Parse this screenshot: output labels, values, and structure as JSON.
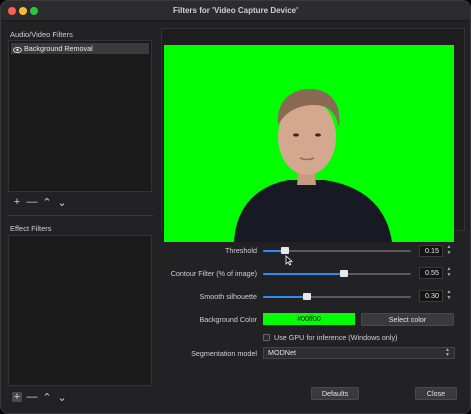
{
  "window": {
    "title": "Filters for 'Video Capture Device'"
  },
  "audio_video_filters": {
    "label": "Audio/Video Filters",
    "items": [
      {
        "label": "Background Removal",
        "visible": true
      }
    ],
    "toolbar": {
      "add": "+",
      "remove": "—",
      "up": "⌃",
      "down": "⌄"
    }
  },
  "effect_filters": {
    "label": "Effect Filters",
    "toolbar": {
      "add": "+",
      "remove": "—",
      "up": "⌃",
      "down": "⌄"
    }
  },
  "properties": {
    "threshold": {
      "label": "Threshold",
      "value": "0.15",
      "fraction": 0.15
    },
    "contour_filter": {
      "label": "Contour Filter (% of image)",
      "value": "0.55",
      "fraction": 0.55
    },
    "smooth_silhouette": {
      "label": "Smooth silhouette",
      "value": "0.30",
      "fraction": 0.3
    },
    "background_color": {
      "label": "Background Color",
      "value": "#00ff00",
      "button": "Select color"
    },
    "use_gpu": {
      "label": "Use GPU for inference (Windows only)",
      "checked": false
    },
    "segmentation_model": {
      "label": "Segmentation model",
      "value": "MODNet"
    }
  },
  "footer": {
    "defaults": "Defaults",
    "close": "Close"
  },
  "colors": {
    "accent": "#2d8cf0",
    "green_screen": "#00ff00",
    "window_bg": "#222224"
  }
}
